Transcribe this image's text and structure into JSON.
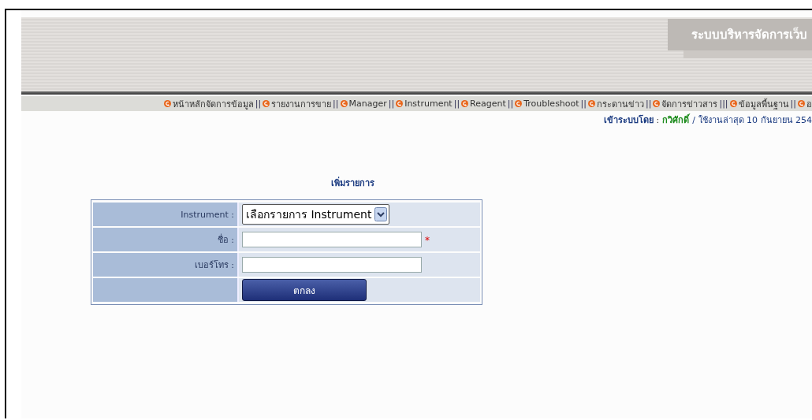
{
  "header": {
    "title": "ระบบบริหารจัดการเว็บ"
  },
  "nav": [
    {
      "label": "หน้าหลักจัดการข้อมูล",
      "separator": "||"
    },
    {
      "label": "รายงานการขาย",
      "separator": "||"
    },
    {
      "label": "Manager",
      "separator": "||"
    },
    {
      "label": "Instrument",
      "separator": "||"
    },
    {
      "label": "Reagent",
      "separator": "||"
    },
    {
      "label": "Troubleshoot",
      "separator": "||"
    },
    {
      "label": "กระดานข่าว",
      "separator": "||"
    },
    {
      "label": "จัดการข่าวสาร",
      "separator": "|||"
    },
    {
      "label": "ข้อมูลพื้นฐาน",
      "separator": "||"
    },
    {
      "label": "อ"
    }
  ],
  "login": {
    "prefix": "เข้าระบบโดย",
    "separator": ":",
    "user": "กวิศักดิ์",
    "last_used": "/ ใช้งานล่าสุด 10 กันยายน 254"
  },
  "form": {
    "title": "เพิ่มรายการ",
    "fields": [
      {
        "kind": "select",
        "label": "Instrument :",
        "value": "เลือกรายการ Instrument"
      },
      {
        "kind": "text",
        "label": "ชื่อ :",
        "required": true,
        "required_mark": "*"
      },
      {
        "kind": "text",
        "label": "เบอร์โทร :"
      }
    ],
    "submit": "ตกลง"
  }
}
